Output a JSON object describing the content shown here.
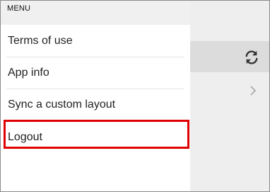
{
  "menu": {
    "header": "MENU",
    "items": [
      {
        "label": "Terms of use"
      },
      {
        "label": "App info"
      },
      {
        "label": "Sync a custom layout"
      },
      {
        "label": "Logout"
      }
    ]
  },
  "background": {
    "toolbar_icon": "sync-icon",
    "row_icon": "chevron-right-icon"
  },
  "annotation": {
    "highlight_color": "#e00000",
    "highlighted_item": "Logout"
  }
}
